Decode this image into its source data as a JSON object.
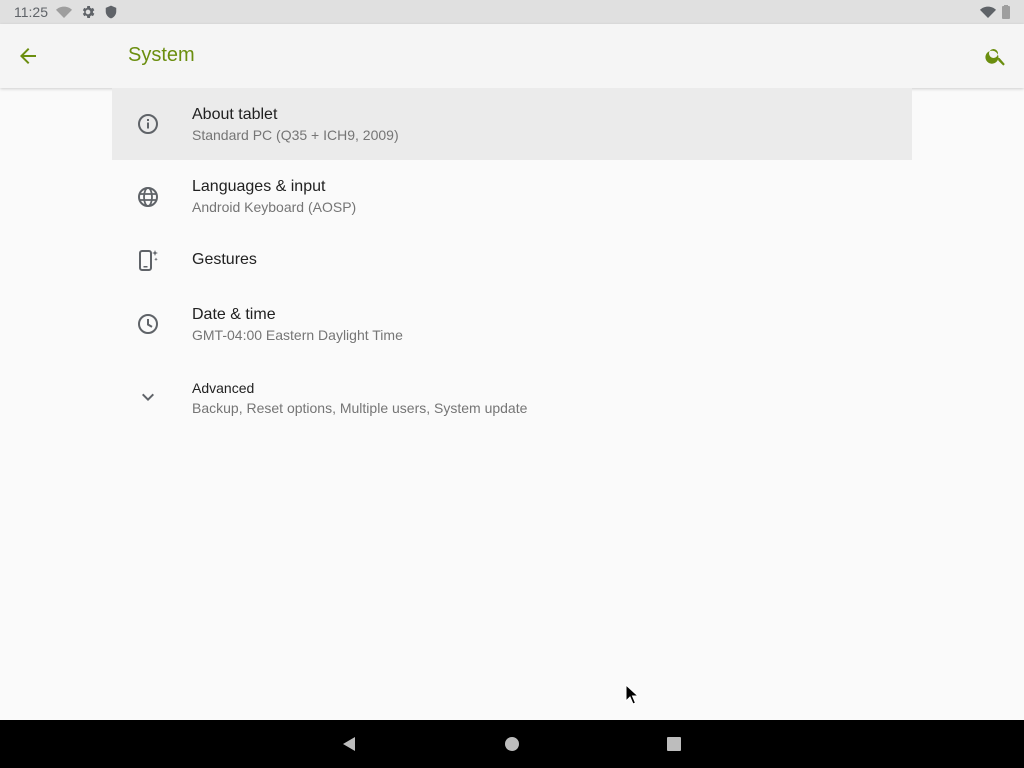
{
  "status_bar": {
    "time": "11:25",
    "icons": [
      "wifi-off-icon",
      "settings-icon",
      "shield-icon",
      "wifi-icon",
      "battery-icon"
    ]
  },
  "app_bar": {
    "title": "System",
    "accent_color": "#6b8e0f",
    "back_icon": "arrow-back-icon",
    "search_icon": "search-icon"
  },
  "items": [
    {
      "title": "About tablet",
      "summary": "Standard PC (Q35 + ICH9, 2009)",
      "icon": "info-icon",
      "selected": true
    },
    {
      "title": "Languages & input",
      "summary": "Android Keyboard (AOSP)",
      "icon": "globe-icon"
    },
    {
      "title": "Gestures",
      "summary": "",
      "icon": "gestures-phone-icon"
    },
    {
      "title": "Date & time",
      "summary": "GMT-04:00 Eastern Daylight Time",
      "icon": "clock-icon"
    },
    {
      "title": "Advanced",
      "summary": "Backup, Reset options, Multiple users, System update",
      "icon": "chevron-down-icon"
    }
  ],
  "nav_bar": {
    "buttons": [
      "back-triangle-icon",
      "home-circle-icon",
      "recents-square-icon"
    ]
  }
}
